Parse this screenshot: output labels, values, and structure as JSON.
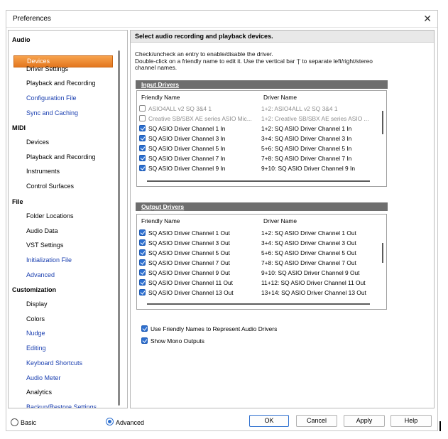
{
  "window": {
    "title": "Preferences",
    "close_glyph": "✕"
  },
  "sidebar": {
    "categories": {
      "audio": "Audio",
      "midi": "MIDI",
      "file": "File",
      "customization": "Customization"
    },
    "audio_items": [
      "Devices",
      "Driver Settings",
      "Playback and Recording",
      "Configuration File",
      "Sync and Caching"
    ],
    "midi_items": [
      "Devices",
      "Playback and Recording",
      "Instruments",
      "Control Surfaces"
    ],
    "file_items": [
      "Folder Locations",
      "Audio Data",
      "VST Settings",
      "Initialization File",
      "Advanced"
    ],
    "customization_items": [
      "Display",
      "Colors",
      "Nudge",
      "Editing",
      "Keyboard Shortcuts",
      "Audio Meter",
      "Analytics",
      "Backup/Restore Settings"
    ],
    "selected": "Devices"
  },
  "main": {
    "header": "Select audio recording and playback devices.",
    "desc1": "Check/uncheck an entry to enable/disable the driver.",
    "desc2": "Double-click on a friendly name to edit it. Use the vertical bar '|' to separate left/right/stereo channel names.",
    "input_title": "Input Drivers",
    "output_title": "Output Drivers",
    "col_friendly": "Friendly Name",
    "col_driver": "Driver Name",
    "input_rows": [
      {
        "fn": "ASIO4ALL v2 SQ 3&4 1",
        "dn": "1+2: ASIO4ALL v2 SQ 3&4 1",
        "checked": false,
        "disabled": true
      },
      {
        "fn": "Creative SB/SBX AE series ASIO Mic...",
        "dn": "1+2: Creative SB/SBX AE series ASIO ...",
        "checked": false,
        "disabled": true
      },
      {
        "fn": "SQ ASIO Driver Channel 1 In",
        "dn": "1+2: SQ ASIO Driver Channel 1 In",
        "checked": true,
        "disabled": false
      },
      {
        "fn": "SQ ASIO Driver Channel 3 In",
        "dn": "3+4: SQ ASIO Driver Channel 3 In",
        "checked": true,
        "disabled": false
      },
      {
        "fn": "SQ ASIO Driver Channel 5 In",
        "dn": "5+6: SQ ASIO Driver Channel 5 In",
        "checked": true,
        "disabled": false
      },
      {
        "fn": "SQ ASIO Driver Channel 7 In",
        "dn": "7+8: SQ ASIO Driver Channel 7 In",
        "checked": true,
        "disabled": false
      },
      {
        "fn": "SQ ASIO Driver Channel 9 In",
        "dn": "9+10: SQ ASIO Driver Channel 9 In",
        "checked": true,
        "disabled": false
      }
    ],
    "output_rows": [
      {
        "fn": "SQ ASIO Driver Channel 1 Out",
        "dn": "1+2: SQ ASIO Driver Channel 1 Out",
        "checked": true
      },
      {
        "fn": "SQ ASIO Driver Channel 3 Out",
        "dn": "3+4: SQ ASIO Driver Channel 3 Out",
        "checked": true
      },
      {
        "fn": "SQ ASIO Driver Channel 5 Out",
        "dn": "5+6: SQ ASIO Driver Channel 5 Out",
        "checked": true
      },
      {
        "fn": "SQ ASIO Driver Channel 7 Out",
        "dn": "7+8: SQ ASIO Driver Channel 7 Out",
        "checked": true
      },
      {
        "fn": "SQ ASIO Driver Channel 9 Out",
        "dn": "9+10: SQ ASIO Driver Channel 9 Out",
        "checked": true
      },
      {
        "fn": "SQ ASIO Driver Channel 11 Out",
        "dn": "11+12: SQ ASIO Driver Channel 11 Out",
        "checked": true
      },
      {
        "fn": "SQ ASIO Driver Channel 13 Out",
        "dn": "13+14: SQ ASIO Driver Channel 13 Out",
        "checked": true
      }
    ],
    "opt_friendly": "Use Friendly Names to Represent Audio Drivers",
    "opt_mono": "Show Mono Outputs",
    "opt_friendly_checked": true,
    "opt_mono_checked": true
  },
  "footer": {
    "basic": "Basic",
    "advanced": "Advanced",
    "mode": "Advanced",
    "ok": "OK",
    "cancel": "Cancel",
    "apply": "Apply",
    "help": "Help"
  },
  "colors": {
    "accent": "#2d6fcf",
    "selection": "#e3771f",
    "link_blue": "#1a3fb0"
  }
}
